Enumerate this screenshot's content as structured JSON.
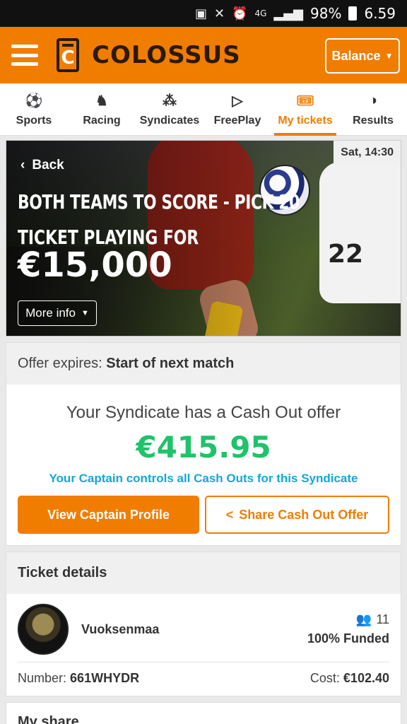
{
  "status": {
    "signal": "4G",
    "battery": "98%",
    "time": "6.59"
  },
  "header": {
    "logo_letter": "C",
    "brand": "COLOSSUS",
    "balance_label": "Balance"
  },
  "nav": {
    "tabs": [
      {
        "label": "Sports",
        "icon": "football-icon"
      },
      {
        "label": "Racing",
        "icon": "horse-icon"
      },
      {
        "label": "Syndicates",
        "icon": "syndicates-icon"
      },
      {
        "label": "FreePlay",
        "icon": "play-icon"
      },
      {
        "label": "My tickets",
        "icon": "ticket-icon",
        "active": true
      },
      {
        "label": "Results",
        "icon": "results-icon"
      }
    ]
  },
  "hero": {
    "back_label": "Back",
    "date": "Sat, 14:30",
    "title": "BOTH TEAMS TO SCORE - PICK 20",
    "playing_for": "TICKET PLAYING FOR",
    "prize": "€15,000",
    "more_info": "More info",
    "jersey_number": "22"
  },
  "offer": {
    "expires_label": "Offer expires:",
    "expires_value": "Start of next match",
    "title": "Your Syndicate has a Cash Out offer",
    "amount": "€415.95",
    "note": "Your Captain controls all Cash Outs for this Syndicate",
    "captain_button": "View Captain Profile",
    "share_button": "Share Cash Out Offer"
  },
  "ticket": {
    "heading": "Ticket details",
    "username": "Vuoksenmaa",
    "members": "11",
    "funded": "100% Funded",
    "number_label": "Number:",
    "number_value": "661WHYDR",
    "cost_label": "Cost:",
    "cost_value": "€102.40"
  },
  "next_section": {
    "heading": "My share"
  },
  "colors": {
    "brand": "#f07d00",
    "amount": "#1fc36a",
    "note": "#16a6d8"
  }
}
